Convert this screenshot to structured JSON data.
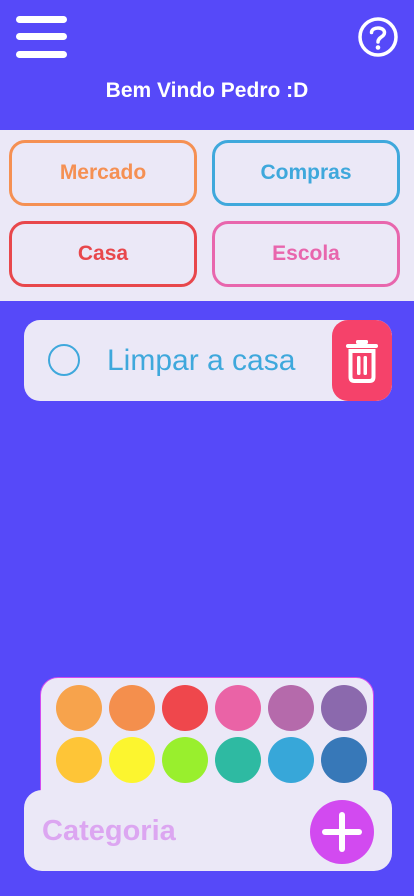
{
  "header": {
    "title": "Bem Vindo Pedro :D",
    "menu_icon": "hamburger-menu-icon",
    "help_icon": "question-circle-icon"
  },
  "categories": [
    {
      "label": "Mercado",
      "color": "#f59053"
    },
    {
      "label": "Compras",
      "color": "#3fa8dc"
    },
    {
      "label": "Casa",
      "color": "#e8474c"
    },
    {
      "label": "Escola",
      "color": "#e866ad"
    }
  ],
  "tasks": [
    {
      "text": "Limpar a casa",
      "done": false,
      "color": "#3fa8dc",
      "delete_icon": "trash-icon"
    }
  ],
  "palette": {
    "colors": [
      [
        "#f7a34c",
        "#f48f4d",
        "#ef474c",
        "#ea63a6",
        "#b56aab",
        "#8b69ad"
      ],
      [
        "#fec537",
        "#fcf52f",
        "#99ef2d",
        "#2ebaa2",
        "#37a7d9",
        "#3778b8"
      ]
    ]
  },
  "new_category": {
    "placeholder": "Categoria",
    "value": "",
    "add_icon": "plus-icon"
  },
  "theme": {
    "background": "#5649f9",
    "panel": "#ebe8f7",
    "accent": "#d24af0",
    "delete": "#f5426a"
  }
}
